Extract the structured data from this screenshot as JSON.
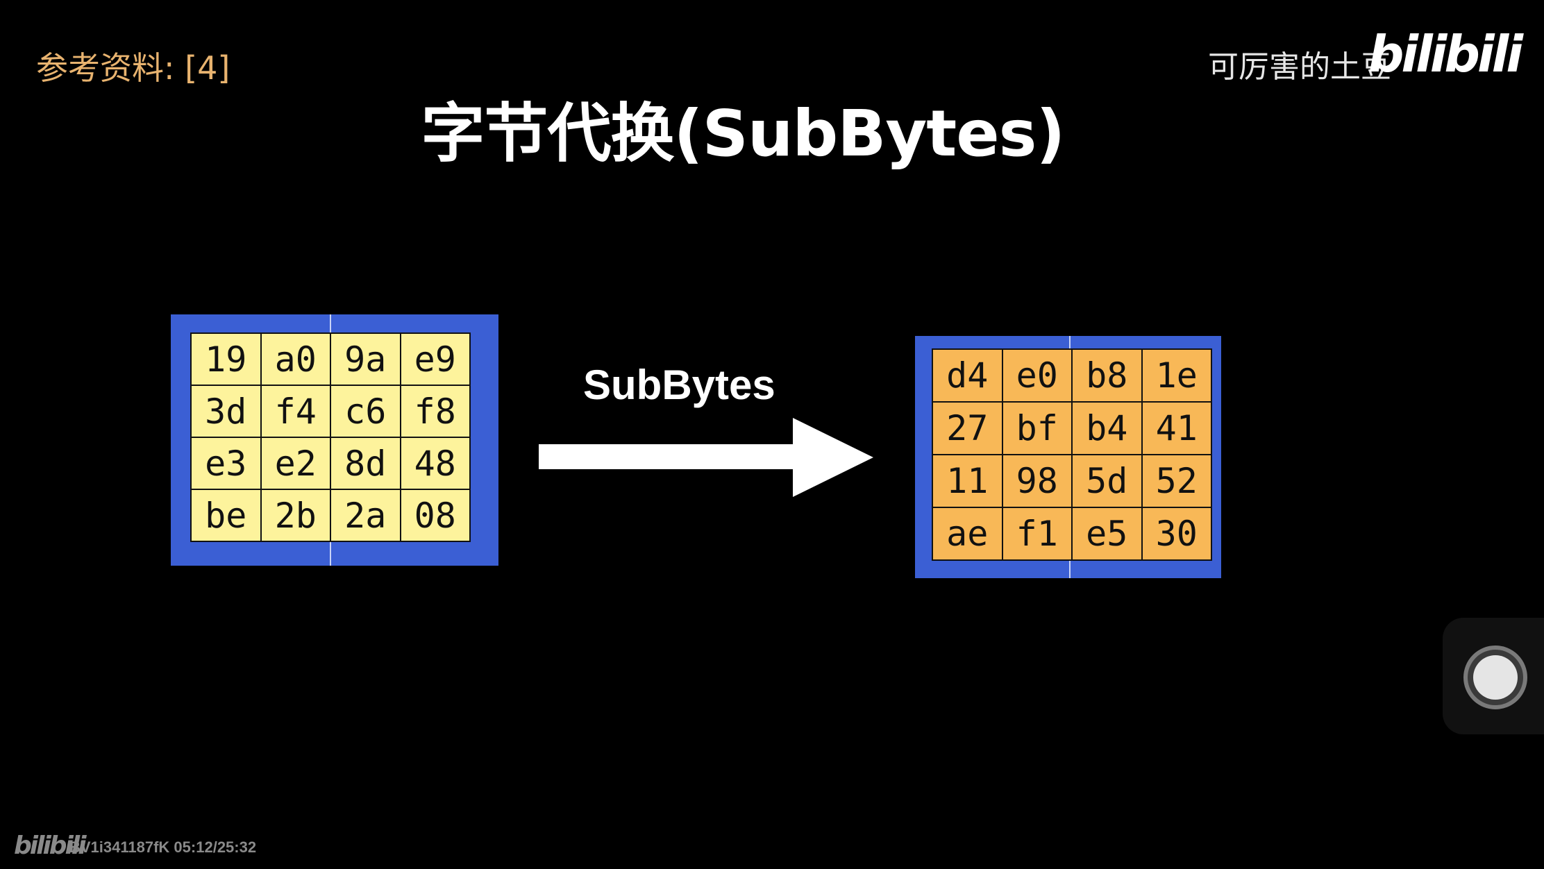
{
  "reference": "参考资料: [4]",
  "title": "字节代换(SubBytes)",
  "channel": {
    "name": "可厉害的土豆",
    "logo": "bilibili"
  },
  "operation_label": "SubBytes",
  "input_matrix": [
    [
      "19",
      "a0",
      "9a",
      "e9"
    ],
    [
      "3d",
      "f4",
      "c6",
      "f8"
    ],
    [
      "e3",
      "e2",
      "8d",
      "48"
    ],
    [
      "be",
      "2b",
      "2a",
      "08"
    ]
  ],
  "output_matrix": [
    [
      "d4",
      "e0",
      "b8",
      "1e"
    ],
    [
      "27",
      "bf",
      "b4",
      "41"
    ],
    [
      "11",
      "98",
      "5d",
      "52"
    ],
    [
      "ae",
      "f1",
      "e5",
      "30"
    ]
  ],
  "footer": {
    "logo": "bilibili",
    "video_info": "BV1i341187fK 05:12/25:32"
  },
  "colors": {
    "background": "#000000",
    "frame_blue": "#3b5fd4",
    "input_cell": "#fdf39c",
    "output_cell": "#f8b857",
    "reference_text": "#e8b36f"
  },
  "icons": {
    "arrow": "right-arrow-icon",
    "record": "record-button-icon"
  }
}
